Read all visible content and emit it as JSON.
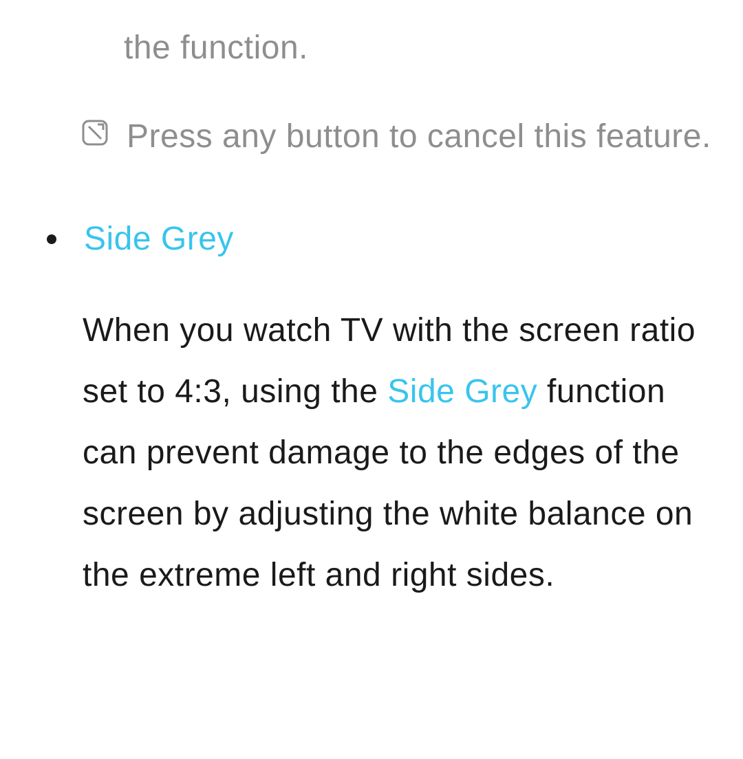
{
  "fragment_tail": "the function.",
  "note_text": "Press any button to cancel this feature.",
  "bullet_heading": "Side Grey",
  "body_pre": "When you watch TV with the screen ratio set to 4:3, using the ",
  "body_term": "Side Grey",
  "body_post": " function can prevent damage to the edges of the screen by adjusting the white balance on the extreme left and right sides.",
  "icons": {
    "note": "note-icon"
  }
}
